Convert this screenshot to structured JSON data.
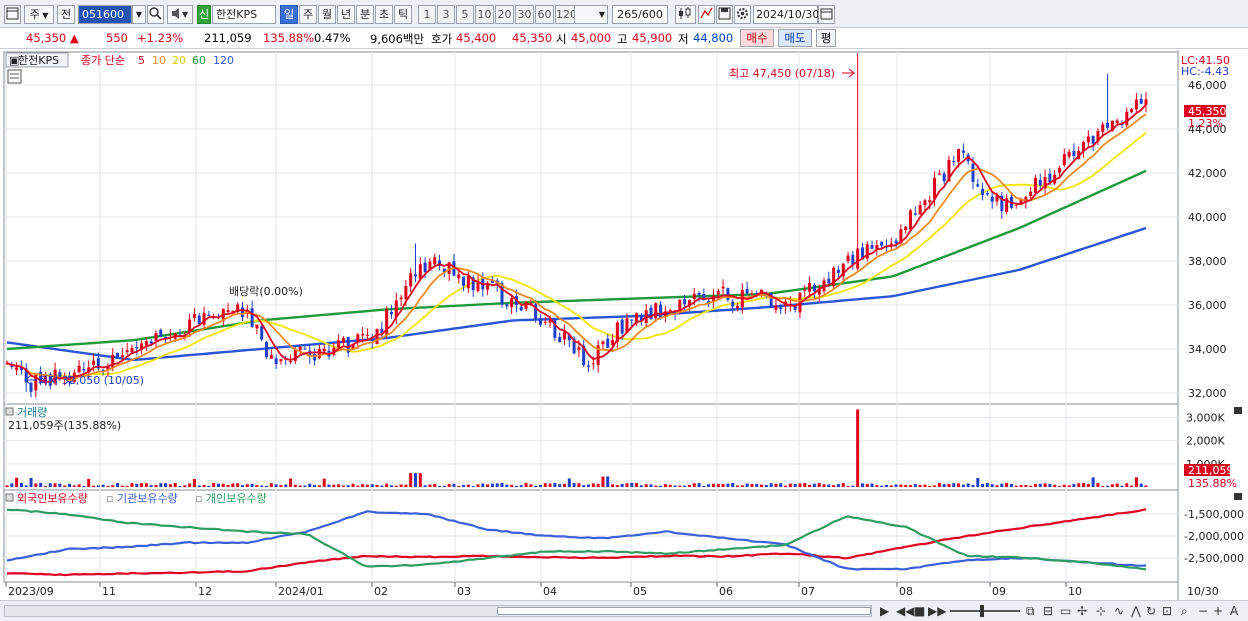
{
  "toolbar": {
    "market_label": "주",
    "prev_label": "전",
    "stock_code": "051600",
    "new_badge": "신",
    "stock_name": "한전KPS",
    "periods": [
      "일",
      "주",
      "월",
      "년",
      "분",
      "초",
      "틱"
    ],
    "active_period": "일",
    "minute_values": [
      "1",
      "3",
      "5",
      "10",
      "20",
      "30",
      "60",
      "120"
    ],
    "count_current": "265",
    "count_total": "/600",
    "date": "2024/10/30"
  },
  "quote": {
    "price": "45,350",
    "direction_arrow": "▲",
    "change": "550",
    "change_pct": "+1.23%",
    "volume": "211,059",
    "volume_ratio": "135.88%",
    "turnover": "0.47%",
    "amount": "9,606백만",
    "ask_label": "호가",
    "ask": "45,400",
    "bid": "45,350",
    "open_label": "시",
    "open": "45,000",
    "high_label": "고",
    "high": "45,900",
    "low_label": "저",
    "low": "44,800",
    "buy_label": "매수",
    "sell_label": "매도",
    "eval_label": "평"
  },
  "price_panel": {
    "stock_tag": "한전KPS",
    "legend_prefix": "종가 단순",
    "ma_periods": [
      "5",
      "10",
      "20",
      "60",
      "120"
    ],
    "lc": "LC:41.50",
    "hc": "HC:-4.43",
    "high_note": "최고 47,450 (07/18)",
    "low_note": "최저 32,050 (10/05)",
    "dividend_note": "배당락(0.00%)",
    "current_price": "45,350",
    "current_pct": "1.23%",
    "y_ticks": [
      "46,000",
      "44,000",
      "42,000",
      "40,000",
      "38,000",
      "36,000",
      "34,000",
      "32,000"
    ]
  },
  "volume_panel": {
    "title": "거래량",
    "value_text": "211,059주(135.88%)",
    "y_ticks": [
      "3,000K",
      "2,000K",
      "1,000K"
    ],
    "current_value": "211,059",
    "current_pct": "135.88%"
  },
  "holdings_panel": {
    "series_labels": [
      "외국인보유수량",
      "기관보유수량",
      "개인보유수량"
    ],
    "y_ticks": [
      "-1,500,000",
      "-2,000,000",
      "-2,500,000"
    ]
  },
  "x_axis": {
    "labels": [
      "2023/09",
      "11",
      "12",
      "2024/01",
      "02",
      "03",
      "04",
      "05",
      "06",
      "07",
      "08",
      "09",
      "10"
    ],
    "last_label": "10/30"
  },
  "colors": {
    "up": "#e0001a",
    "down": "#1e3fc8",
    "ma5": "#e00020",
    "ma10": "#ef8a1c",
    "ma20": "#f2e600",
    "ma60": "#1f9a3a",
    "ma120": "#2a55d6",
    "foreign": "#e00020",
    "institution": "#3a5fd8",
    "individual": "#2e9c62"
  },
  "chart_data": {
    "type": "candlestick",
    "price_range": [
      31500,
      47500
    ],
    "anchors": [
      {
        "date": "2023/09",
        "price": 33600
      },
      {
        "date": "2023/10/05",
        "price": 32300
      },
      {
        "date": "2023/11",
        "price": 33300
      },
      {
        "date": "2023/12",
        "price": 35200
      },
      {
        "date": "2023/12 배당락",
        "price": 36000
      },
      {
        "date": "2024/01",
        "price": 33400
      },
      {
        "date": "2024/02",
        "price": 34400
      },
      {
        "date": "2024/02 late",
        "price": 38000
      },
      {
        "date": "2024/03",
        "price": 37500
      },
      {
        "date": "2024/04",
        "price": 35500
      },
      {
        "date": "2024/04 late",
        "price": 33300
      },
      {
        "date": "2024/05",
        "price": 35500
      },
      {
        "date": "2024/06",
        "price": 36400
      },
      {
        "date": "2024/07",
        "price": 36200
      },
      {
        "date": "2024/07/18",
        "price": 38200
      },
      {
        "date": "2024/08",
        "price": 39200
      },
      {
        "date": "2024/08 mid",
        "price": 42800
      },
      {
        "date": "2024/09",
        "price": 40400
      },
      {
        "date": "2024/10",
        "price": 42500
      },
      {
        "date": "2024/10/30",
        "price": 45350
      }
    ],
    "ma60_path": [
      34000,
      34400,
      35300,
      35800,
      36100,
      36300,
      36500,
      37300,
      39500,
      42100
    ],
    "ma120_path": [
      34300,
      33500,
      34000,
      34500,
      35300,
      35500,
      35900,
      36400,
      37600,
      39500
    ],
    "volume_range_k": [
      0,
      3500
    ],
    "holdings_range": [
      -3000000,
      -1000000
    ]
  }
}
